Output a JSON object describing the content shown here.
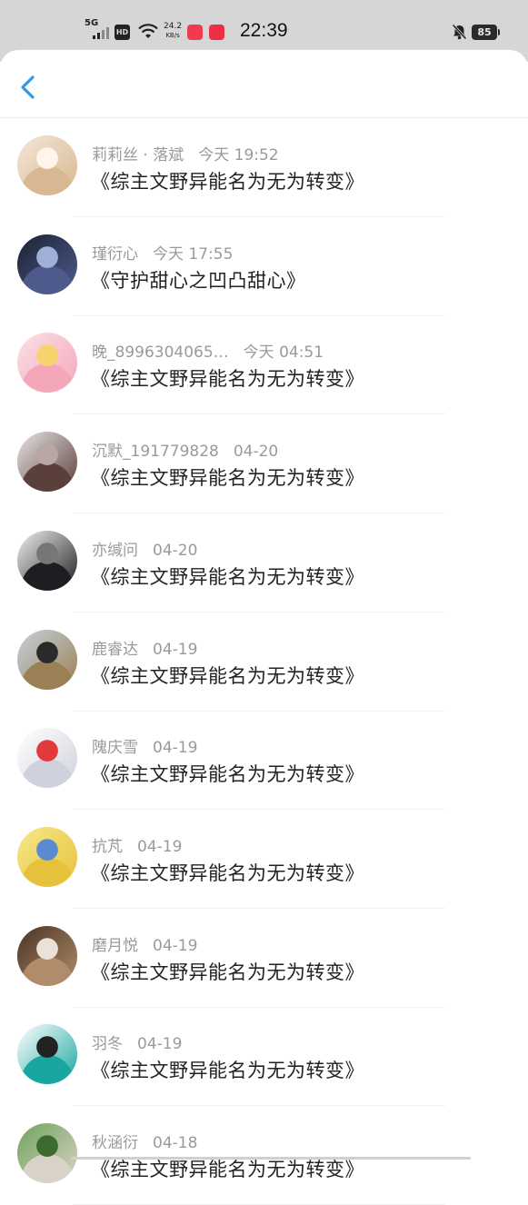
{
  "status_bar": {
    "network": "5G",
    "hd": "HD",
    "speed_value": "24.2",
    "speed_unit": "KB/s",
    "time": "22:39",
    "battery": "85"
  },
  "header": {
    "back_icon": "chevron-left-icon"
  },
  "colors": {
    "accent": "#2f9be8",
    "status_bar_bg": "#d6d6d6",
    "meta_text": "#9a9a9a",
    "title_text": "#222222"
  },
  "items": [
    {
      "name": "莉莉丝 · 落斌",
      "time": "今天 19:52",
      "book": "《综主文野异能名为无为转变》",
      "avatar_colors": [
        "#f3e6d6",
        "#d8b892",
        "#fff5ea"
      ]
    },
    {
      "name": "瑾衍心",
      "time": "今天 17:55",
      "book": "《守护甜心之凹凸甜心》",
      "avatar_colors": [
        "#1c2233",
        "#4d5b8c",
        "#9fb0d8"
      ]
    },
    {
      "name": "晚_8996304065…",
      "time": "今天 04:51",
      "book": "《综主文野异能名为无为转变》",
      "avatar_colors": [
        "#fbe0e6",
        "#f4a7b9",
        "#f7d36b"
      ]
    },
    {
      "name": "沉默_191779828",
      "time": "04-20",
      "book": "《综主文野异能名为无为转变》",
      "avatar_colors": [
        "#e8e4e4",
        "#5a3f3a",
        "#b9a7a3"
      ]
    },
    {
      "name": "亦缄问",
      "time": "04-20",
      "book": "《综主文野异能名为无为转变》",
      "avatar_colors": [
        "#f1f1f1",
        "#1e1e22",
        "#777777"
      ]
    },
    {
      "name": "鹿睿达",
      "time": "04-19",
      "book": "《综主文野异能名为无为转变》",
      "avatar_colors": [
        "#c5d1da",
        "#9b7f55",
        "#2a2a2a"
      ]
    },
    {
      "name": "隗庆雪",
      "time": "04-19",
      "book": "《综主文野异能名为无为转变》",
      "avatar_colors": [
        "#ffffff",
        "#cfd2dc",
        "#e23a3a"
      ]
    },
    {
      "name": "抗芃",
      "time": "04-19",
      "book": "《综主文野异能名为无为转变》",
      "avatar_colors": [
        "#f6e88a",
        "#e6c23c",
        "#5a8bd0"
      ]
    },
    {
      "name": "磨月悦",
      "time": "04-19",
      "book": "《综主文野异能名为无为转变》",
      "avatar_colors": [
        "#4a3426",
        "#b08c6a",
        "#eae2d8"
      ]
    },
    {
      "name": "羽冬",
      "time": "04-19",
      "book": "《综主文野异能名为无为转变》",
      "avatar_colors": [
        "#ffffff",
        "#1aa6a0",
        "#222222"
      ]
    },
    {
      "name": "秋涵衍",
      "time": "04-18",
      "book": "《综主文野异能名为无为转变》",
      "avatar_colors": [
        "#6fa35a",
        "#d9d2c8",
        "#3d6b2e"
      ]
    }
  ]
}
